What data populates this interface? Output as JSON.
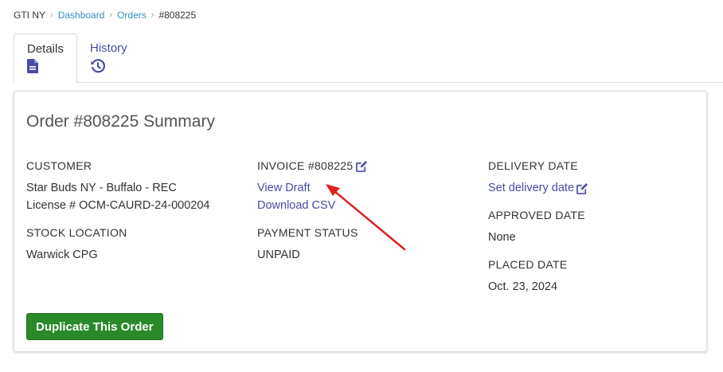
{
  "breadcrumb": {
    "root": "GTI NY",
    "items": [
      "Dashboard",
      "Orders"
    ],
    "current": "#808225"
  },
  "tabs": [
    {
      "label": "Details",
      "icon": "file-document-icon",
      "active": true
    },
    {
      "label": "History",
      "icon": "history-icon",
      "active": false
    }
  ],
  "summary": {
    "title": "Order #808225 Summary",
    "customer": {
      "label": "CUSTOMER",
      "name": "Star Buds NY - Buffalo - REC",
      "license": "License # OCM-CAURD-24-000204"
    },
    "stock_location": {
      "label": "STOCK LOCATION",
      "value": "Warwick CPG"
    },
    "invoice": {
      "label": "INVOICE #808225",
      "view_draft": "View Draft",
      "download_csv": "Download CSV"
    },
    "payment_status": {
      "label": "PAYMENT STATUS",
      "value": "UNPAID"
    },
    "delivery_date": {
      "label": "DELIVERY DATE",
      "link": "Set delivery date"
    },
    "approved_date": {
      "label": "APPROVED DATE",
      "value": "None"
    },
    "placed_date": {
      "label": "PLACED DATE",
      "value": "Oct. 23, 2024"
    },
    "duplicate_button": "Duplicate This Order"
  },
  "colors": {
    "link": "#4a4aa8",
    "breadcrumb_link": "#3a8fb7",
    "button_green": "#2a8a2a",
    "annotation_arrow": "#e02020"
  }
}
